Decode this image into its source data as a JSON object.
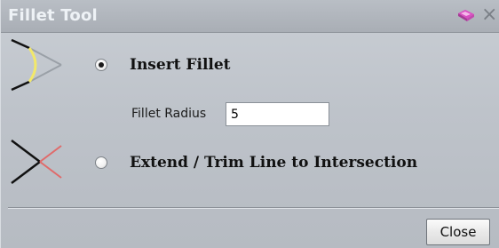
{
  "window": {
    "title": "Fillet Tool",
    "pin_icon": "pin-icon",
    "close_glyph": "×"
  },
  "options": [
    {
      "label": "Insert Fillet",
      "selected": true,
      "icon": "fillet-corner-icon"
    },
    {
      "label": "Extend / Trim Line to Intersection",
      "selected": false,
      "icon": "trim-intersection-icon"
    }
  ],
  "fillet_radius": {
    "label": "Fillet Radius",
    "value": "5"
  },
  "footer": {
    "close_label": "Close"
  },
  "colors": {
    "fillet_arc": "#f2e86a",
    "trim_accent": "#e06a6a",
    "guide_line": "#9aa0a7"
  }
}
